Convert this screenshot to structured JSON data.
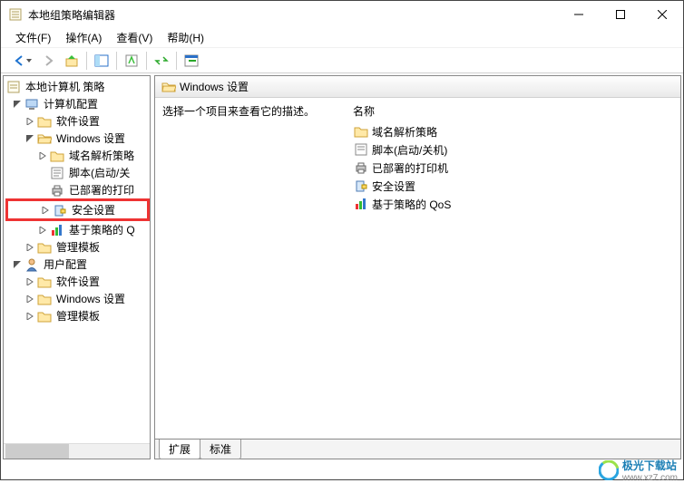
{
  "window": {
    "title": "本地组策略编辑器"
  },
  "menu": {
    "file": "文件(F)",
    "action": "操作(A)",
    "view": "查看(V)",
    "help": "帮助(H)"
  },
  "tree": {
    "root": "本地计算机 策略",
    "computerCfg": "计算机配置",
    "softwareSettings": "软件设置",
    "windowsSettings": "Windows 设置",
    "nameResPolicy": "域名解析策略",
    "scripts": "脚本(启动/关",
    "deployedPrinters": "已部署的打印",
    "security": "安全设置",
    "policyQoS": "基于策略的 Q",
    "adminTemplates": "管理模板",
    "userCfg": "用户配置",
    "userSoftware": "软件设置",
    "userWindows": "Windows 设置",
    "userAdmin": "管理模板"
  },
  "right": {
    "headerTitle": "Windows 设置",
    "description": "选择一个项目来查看它的描述。",
    "colName": "名称",
    "items": {
      "nameRes": "域名解析策略",
      "scripts": "脚本(启动/关机)",
      "printers": "已部署的打印机",
      "security": "安全设置",
      "qos": "基于策略的 QoS"
    }
  },
  "tabs": {
    "extended": "扩展",
    "standard": "标准"
  },
  "footer": {
    "site": "极光下载站",
    "url": "www.xz7.com"
  }
}
